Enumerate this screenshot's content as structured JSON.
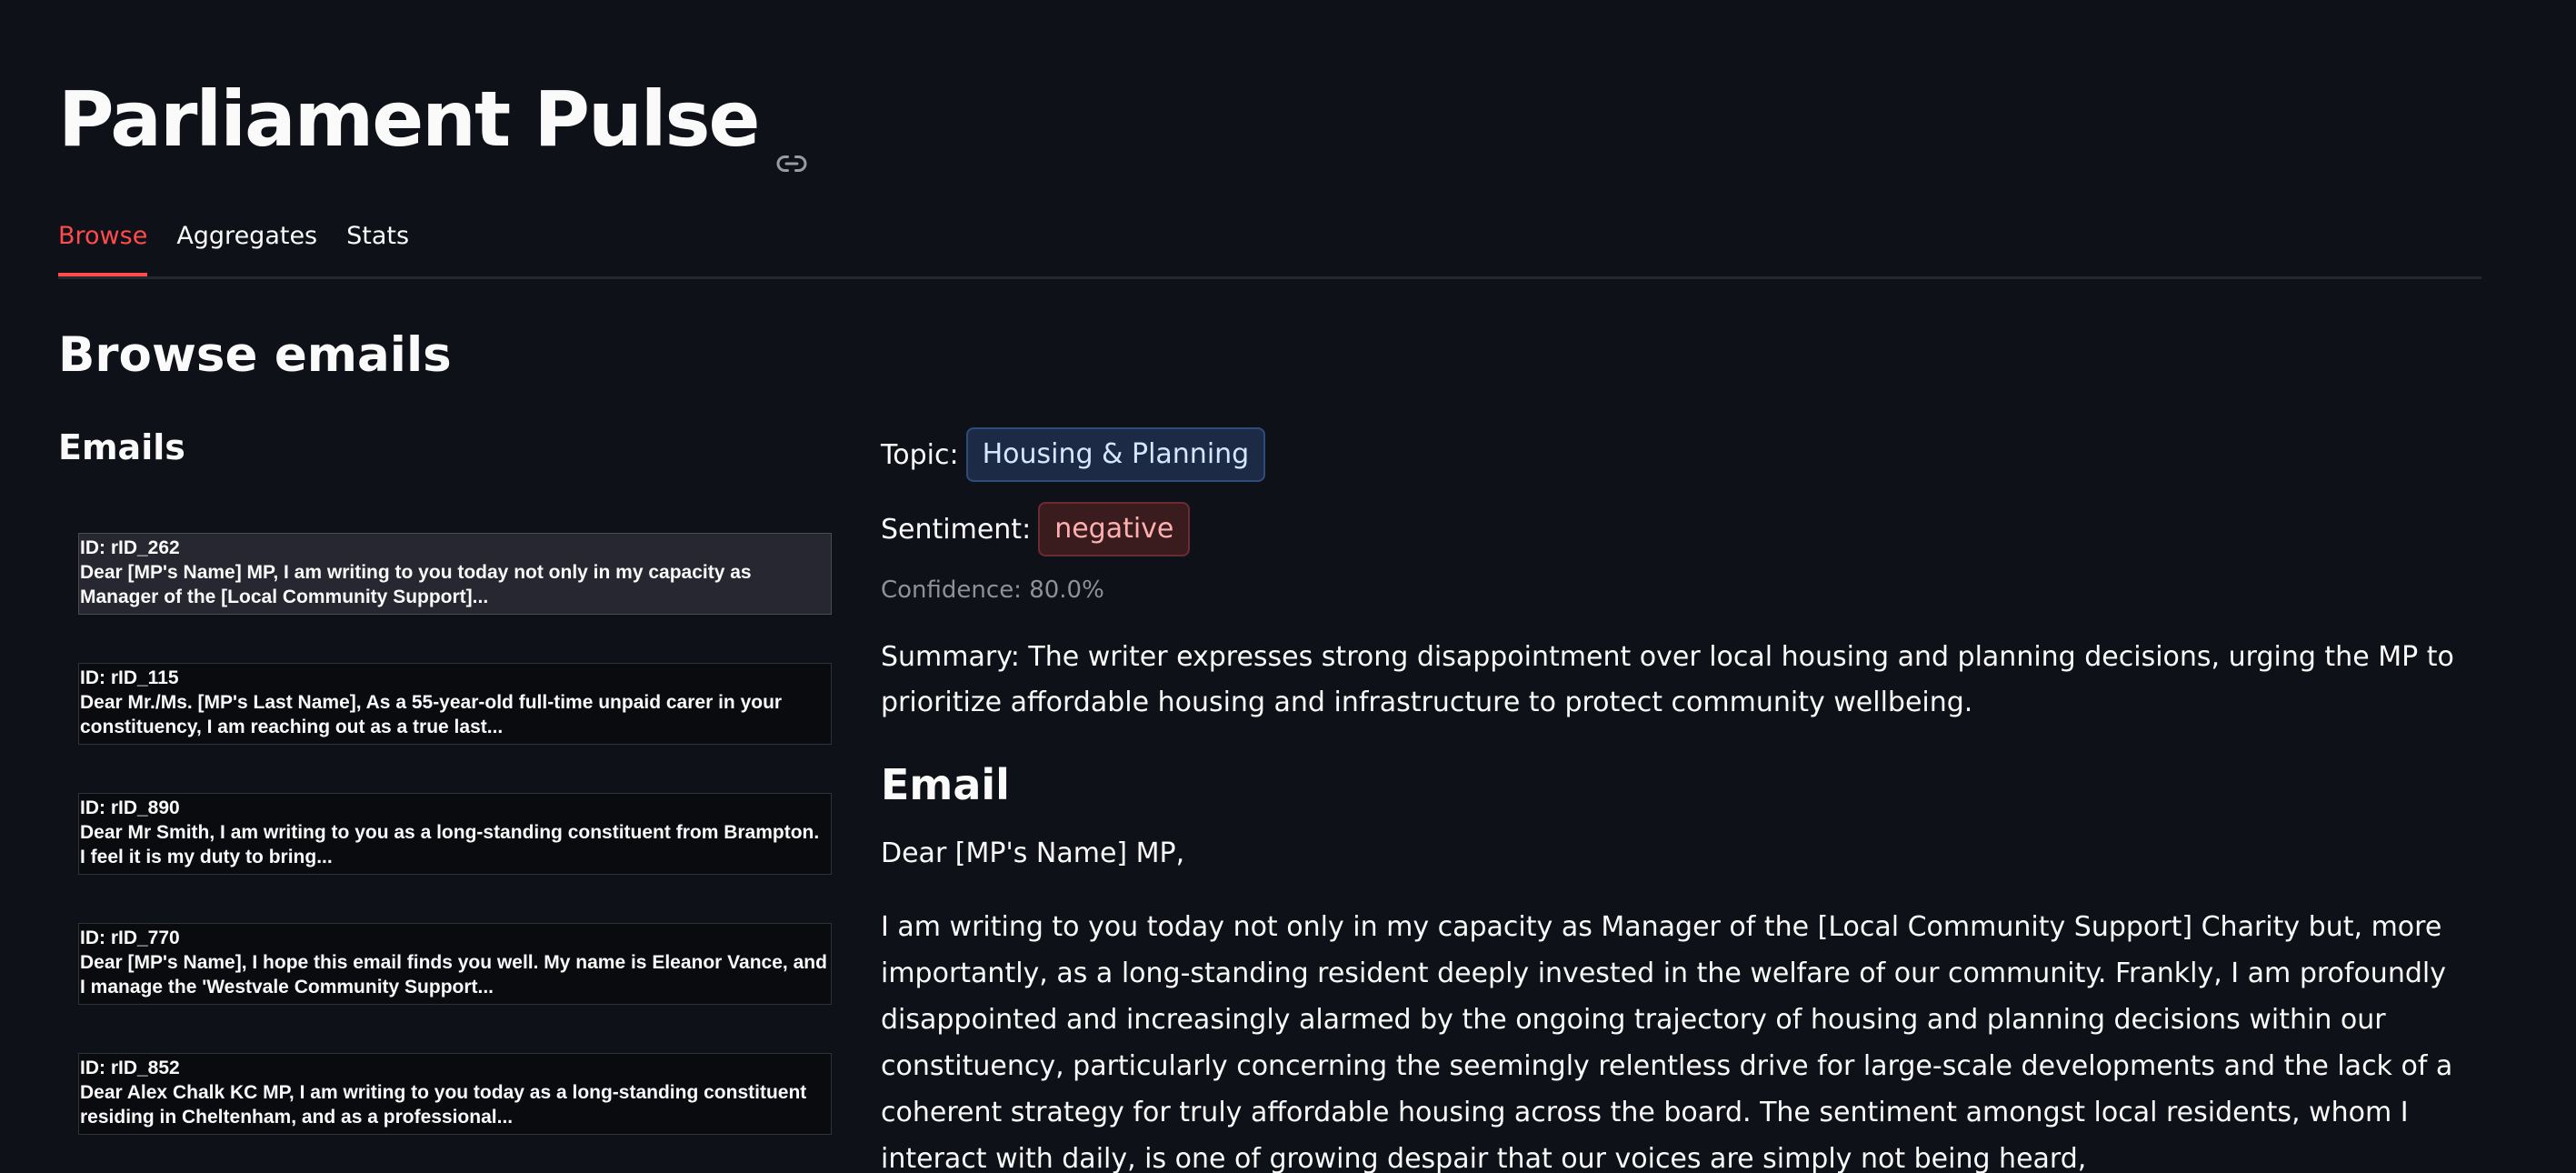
{
  "app": {
    "title": "Parliament Pulse"
  },
  "tabs": [
    {
      "label": "Browse",
      "active": true
    },
    {
      "label": "Aggregates",
      "active": false
    },
    {
      "label": "Stats",
      "active": false
    }
  ],
  "section_title": "Browse emails",
  "emails_column": {
    "title": "Emails",
    "items": [
      {
        "id": "ID: rID_262",
        "preview": "Dear [MP's Name] MP, I am writing to you today not only in my capacity as Manager of the [Local Community Support]...",
        "selected": true
      },
      {
        "id": "ID: rID_115",
        "preview": "Dear Mr./Ms. [MP's Last Name], As a 55-year-old full-time unpaid carer in your constituency, I am reaching out as a true last...",
        "selected": false
      },
      {
        "id": "ID: rID_890",
        "preview": "Dear Mr Smith, I am writing to you as a long-standing constituent from Brampton. I feel it is my duty to bring...",
        "selected": false
      },
      {
        "id": "ID: rID_770",
        "preview": "Dear [MP's Name], I hope this email finds you well. My name is Eleanor Vance, and I manage the 'Westvale Community Support...",
        "selected": false
      },
      {
        "id": "ID: rID_852",
        "preview": "Dear Alex Chalk KC MP, I am writing to you today as a long-standing constituent residing in Cheltenham, and as a professional...",
        "selected": false
      }
    ]
  },
  "detail": {
    "topic_label": "Topic:",
    "topic_value": "Housing & Planning",
    "sentiment_label": "Sentiment:",
    "sentiment_value": "negative",
    "confidence": "Confidence: 80.0%",
    "summary": "Summary: The writer expresses strong disappointment over local housing and planning decisions, urging the MP to prioritize affordable housing and infrastructure to protect community wellbeing.",
    "email_heading": "Email",
    "email_greeting": "Dear [MP's Name] MP,",
    "email_body": "I am writing to you today not only in my capacity as Manager of the [Local Community Support] Charity but, more importantly, as a long-standing resident deeply invested in the welfare of our community. Frankly, I am profoundly disappointed and increasingly alarmed by the ongoing trajectory of housing and planning decisions within our constituency, particularly concerning the seemingly relentless drive for large-scale developments and the lack of a coherent strategy for truly affordable housing across the board. The sentiment amongst local residents, whom I interact with daily, is one of growing despair that our voices are simply not being heard,"
  },
  "colors": {
    "background": "#0e1117",
    "accent": "#ff4b4b",
    "topic_badge_bg": "#1c2a45",
    "sentiment_badge_bg": "#3a1c1f"
  },
  "icons": {
    "title_anchor": "link-icon"
  }
}
